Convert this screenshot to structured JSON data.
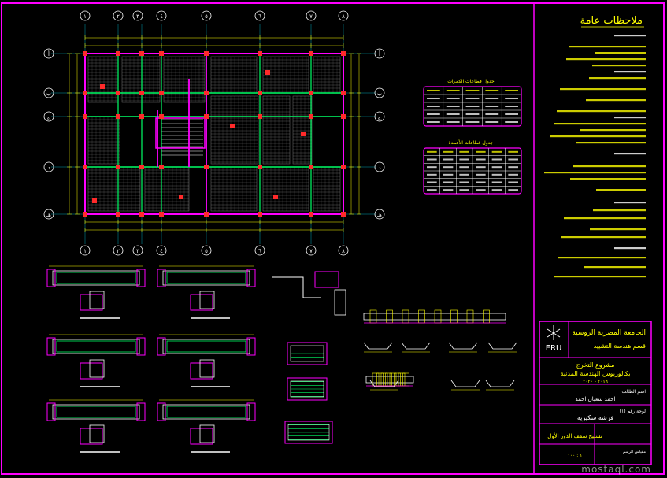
{
  "drawing": {
    "colors": {
      "background": "#000000",
      "frame": "#ff00ff",
      "grid_line": "#00e5ff",
      "wall": "#ff00ff",
      "beam": "#00ff66",
      "hatch": "#c8c8c8",
      "column": "#ff2a2a",
      "dimension": "#ffff00",
      "text": "#ffffff",
      "notes_text": "#ffff00"
    },
    "grid_bubbles_top": [
      "١",
      "٢",
      "٣",
      "٤",
      "٥",
      "٦",
      "٧",
      "٨"
    ],
    "grid_bubbles_bottom": [
      "١",
      "٢",
      "٣",
      "٤",
      "٥",
      "٦",
      "٧",
      "٨"
    ],
    "grid_bubbles_left": [
      "أ",
      "ب",
      "ج",
      "د",
      "هـ"
    ],
    "grid_bubbles_right": [
      "أ",
      "ب",
      "ج",
      "د",
      "هـ"
    ]
  },
  "notes": {
    "title": "ملاحظات عامة"
  },
  "tables": [
    {
      "title": "جدول قطاعات الكمرات",
      "rows": 5,
      "cols": 5
    },
    {
      "title": "جدول قطاعات الأعمدة",
      "rows": 6,
      "cols": 6
    }
  ],
  "title_block": {
    "university": "الجامعة المصرية الروسية",
    "department": "قسم هندسة التشييد",
    "logo_text": "ERU",
    "project_line1": "مشروع التخرج",
    "project_line2": "بكالوريوس الهندسة المدنية",
    "year": "٢٠١٩ - ٢٠٢٠",
    "student_label": "اسم الطالب",
    "student_name": "احمد شعبان احمد",
    "sheet_label": "لوحة رقم (١)",
    "sheet_title": "فرشة سكيرية",
    "drawing_title": "تسليح سقف الدور الأول",
    "scale_label": "مقياس الرسم",
    "scale_value": "١ : ١٠٠"
  },
  "watermark": "mostaql.com"
}
